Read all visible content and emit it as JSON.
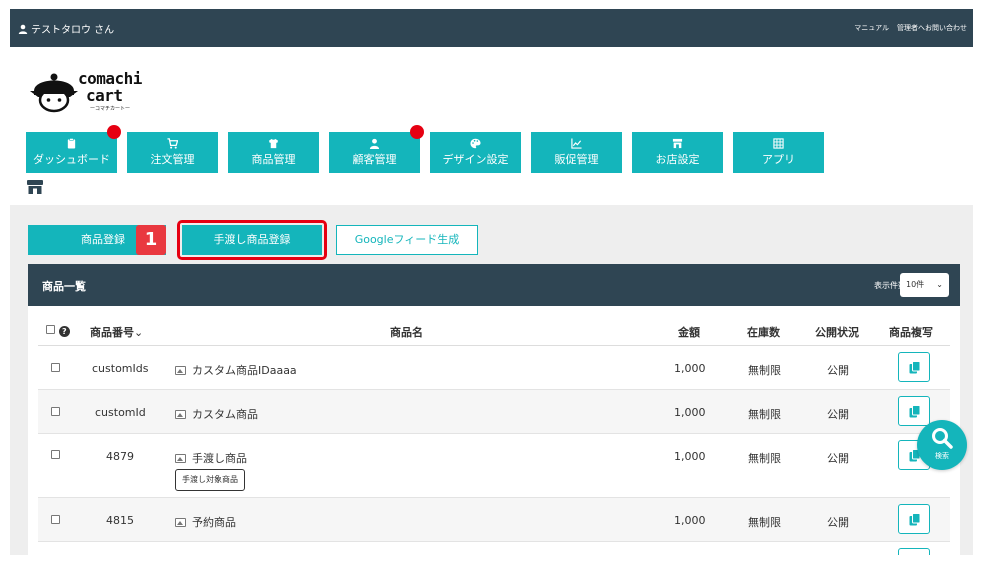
{
  "topbar": {
    "user_name": "テストタロウ さん",
    "links": [
      "マニュアル",
      "管理者へお問い合わせ"
    ]
  },
  "logo": {
    "line1": "comachi",
    "line2": "cart",
    "tagline": "ーコマチカートー"
  },
  "nav": {
    "items": [
      {
        "label": "ダッシュボード",
        "icon": "clipboard-icon",
        "notify": true
      },
      {
        "label": "注文管理",
        "icon": "cart-icon",
        "notify": false
      },
      {
        "label": "商品管理",
        "icon": "tshirt-icon",
        "notify": false
      },
      {
        "label": "顧客管理",
        "icon": "user-icon",
        "notify": true
      },
      {
        "label": "デザイン設定",
        "icon": "palette-icon",
        "notify": false
      },
      {
        "label": "販促管理",
        "icon": "chart-icon",
        "notify": false
      },
      {
        "label": "お店設定",
        "icon": "store-icon",
        "notify": false
      },
      {
        "label": "アプリ",
        "icon": "grid-icon",
        "notify": false
      }
    ],
    "accent_color": "#14b5bb",
    "notify_color": "#e60012"
  },
  "actions": {
    "register_label": "商品登録",
    "step_badge": "1",
    "handover_register_label": "手渡し商品登録",
    "google_feed_label": "Googleフィード生成"
  },
  "panel": {
    "title": "商品一覧",
    "per_page_label": "表示件数",
    "per_page_value": "10件",
    "headers": {
      "help": "?",
      "product_number": "商品番号",
      "product_name": "商品名",
      "price": "金額",
      "stock": "在庫数",
      "status": "公開状況",
      "copy": "商品複写"
    },
    "rows": [
      {
        "number": "customIds",
        "name": "カスタム商品IDaaaa",
        "price": "1,000",
        "stock": "無制限",
        "status": "公開",
        "tag": ""
      },
      {
        "number": "customId",
        "name": "カスタム商品",
        "price": "1,000",
        "stock": "無制限",
        "status": "公開",
        "tag": ""
      },
      {
        "number": "4879",
        "name": "手渡し商品",
        "price": "1,000",
        "stock": "無制限",
        "status": "公開",
        "tag": "手渡し対象商品"
      },
      {
        "number": "4815",
        "name": "予約商品",
        "price": "1,000",
        "stock": "無制限",
        "status": "公開",
        "tag": ""
      }
    ]
  },
  "search_fab": {
    "label": "検索"
  },
  "colors": {
    "header_bg": "#2f4553",
    "accent": "#14b5bb",
    "highlight": "#e60012"
  }
}
